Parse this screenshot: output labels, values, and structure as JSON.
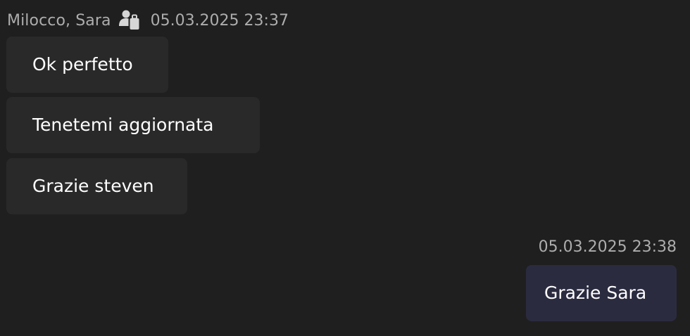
{
  "incoming": {
    "sender": "Milocco, Sara",
    "status_icon": "out-of-office-icon",
    "timestamp": "05.03.2025 23:37",
    "messages": [
      {
        "text": "Ok perfetto"
      },
      {
        "text": "Tenetemi aggiornata"
      },
      {
        "text": "Grazie steven"
      }
    ]
  },
  "outgoing": {
    "timestamp": "05.03.2025 23:38",
    "messages": [
      {
        "text": "Grazie Sara"
      }
    ]
  },
  "colors": {
    "background": "#1f1f1f",
    "incoming_bubble": "#292929",
    "outgoing_bubble": "#2b2b40",
    "meta_text": "#adadad",
    "message_text": "#ffffff"
  }
}
